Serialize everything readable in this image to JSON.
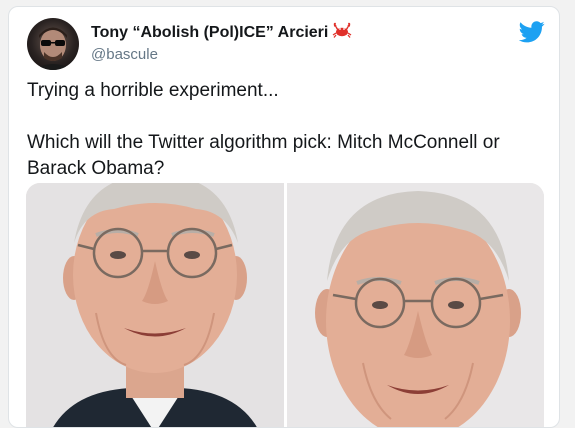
{
  "tweet": {
    "author_name": "Tony “Abolish (Pol)ICE” Arcieri",
    "author_emoji": "🦀",
    "handle": "@bascule",
    "text_line1": "Trying a horrible experiment...",
    "text_line2": "Which will the Twitter algorithm pick: Mitch McConnell or Barack Obama?"
  },
  "icons": {
    "brand": "twitter-bird-icon",
    "avatar": "avatar-photo",
    "media_left": "photo-mitch-mcconnell-1",
    "media_right": "photo-mitch-mcconnell-2"
  },
  "colors": {
    "brand_blue": "#1da1f2",
    "text": "#14171a",
    "secondary": "#657786"
  }
}
